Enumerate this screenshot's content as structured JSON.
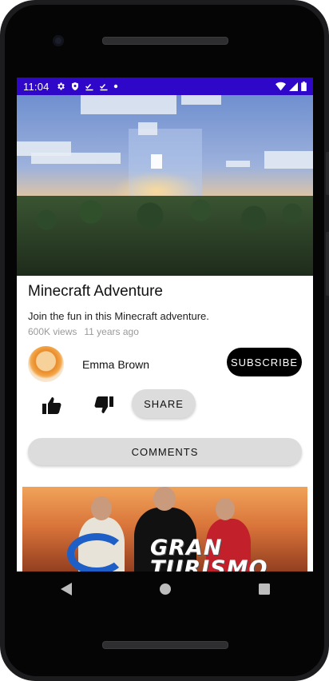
{
  "status_bar": {
    "time": "11:04",
    "left_icons": [
      "gear-icon",
      "shield-icon",
      "task-check-icon",
      "task-check-icon",
      "dot-icon"
    ],
    "right_icons": [
      "wifi-icon",
      "cell-signal-icon",
      "battery-icon"
    ],
    "color": "#2f07c9"
  },
  "video": {
    "title": "Minecraft Adventure",
    "description": "Join the fun in this Minecraft adventure.",
    "views": "600K views",
    "age": "11 years ago"
  },
  "channel": {
    "name": "Emma Brown",
    "subscribe_label": "SUBSCRIBE"
  },
  "actions": {
    "like_icon": "thumbs-up-icon",
    "dislike_icon": "thumbs-down-icon",
    "share_label": "SHARE",
    "comments_label": "COMMENTS"
  },
  "next_video": {
    "thumbnail_text_line1": "GRAN",
    "thumbnail_text_line2": "TURISMO"
  },
  "nav": {
    "back_icon": "back-triangle-icon",
    "home_icon": "home-circle-icon",
    "recents_icon": "recents-square-icon"
  }
}
